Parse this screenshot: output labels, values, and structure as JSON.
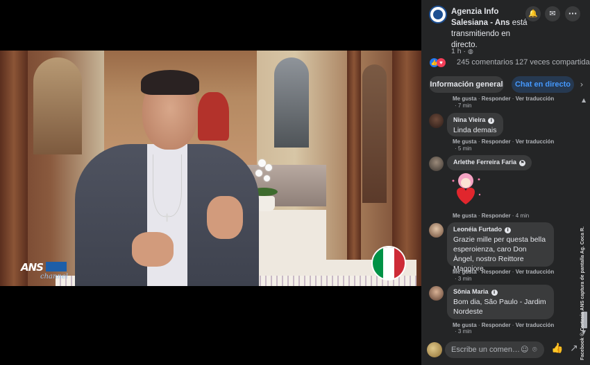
{
  "video": {
    "channel_logo": "ANS channel",
    "channel_logo_text": "ANS",
    "channel_logo_sub": "channel",
    "flag": "italy-flag",
    "flag_colors": [
      "#009246",
      "#ffffff",
      "#ce2b37"
    ]
  },
  "watermark": "Facebook © Cortesia ANS captura de pantalla Ag. Coca R.",
  "post": {
    "page_name": "Agenzia Info Salesiana - Ans",
    "status_text": "está transmitiendo en directo.",
    "time": "1 h ·",
    "privacy_icon": "globe-icon",
    "comments_count": "245 comentarios",
    "shares_count": "127 veces compartida",
    "reactions": [
      "like",
      "love"
    ]
  },
  "header_buttons": [
    {
      "name": "bell-icon",
      "glyph": "🔔"
    },
    {
      "name": "messenger-icon",
      "glyph": "✉"
    },
    {
      "name": "more-icon",
      "glyph": "···"
    }
  ],
  "tabs": {
    "info": "Información general",
    "chat": "Chat en directo",
    "next": "›"
  },
  "comment_actions": {
    "like": "Me gusta",
    "reply": "Responder",
    "translate": "Ver traducción"
  },
  "comments": [
    {
      "name": "",
      "text": "",
      "time": "7 min",
      "partial": true
    },
    {
      "name": "Nina Vieira",
      "text": "Linda demais",
      "time": "5 min",
      "badge": "i"
    },
    {
      "name": "Arlethe Ferreira Faria",
      "text": "",
      "time": "4 min",
      "badge": "⚑",
      "sticker": "heart-hug-sticker"
    },
    {
      "name": "Leonéia Furtado",
      "text": "Grazie mille per questa bella esperoienza, caro Don Àngel, nostro Reittore Maggiore",
      "time": "3 min",
      "badge": "i"
    },
    {
      "name": "Sônia Maria",
      "text": "Bom dia, São Paulo - Jardim Nordeste",
      "time": "3 min",
      "badge": "i"
    }
  ],
  "composer": {
    "placeholder": "Escribe un comen…",
    "emoji_icon": "☺",
    "camera_icon": "⌾",
    "like_icon": "👍",
    "share_icon": "↗"
  },
  "colors": {
    "panel_bg": "#242526",
    "bubble_bg": "#3a3b3c",
    "accent_blue": "#4599ff",
    "text_primary": "#e4e6eb",
    "text_secondary": "#b0b3b8"
  }
}
